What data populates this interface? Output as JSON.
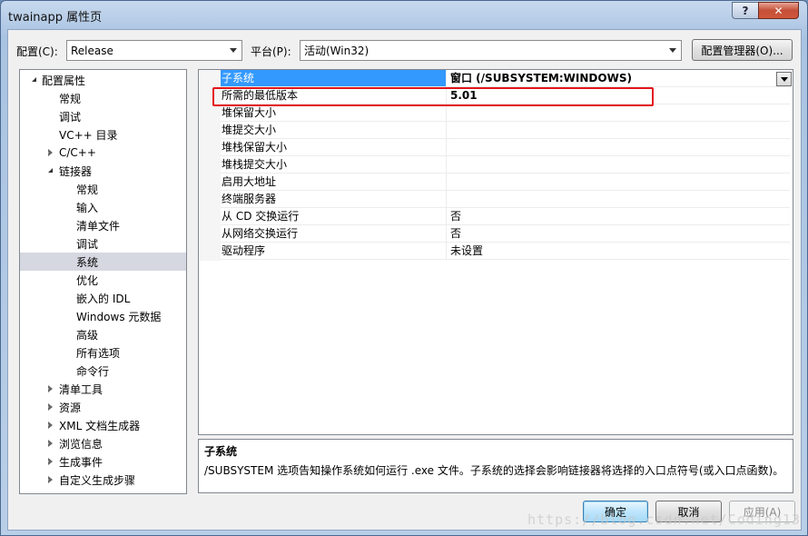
{
  "window": {
    "title": "twainapp 属性页",
    "help_label": "?",
    "close_label": "✕"
  },
  "toolbar": {
    "config_label": "配置(C):",
    "config_value": "Release",
    "platform_label": "平台(P):",
    "platform_value": "活动(Win32)",
    "config_manager_label": "配置管理器(O)..."
  },
  "tree": {
    "items": [
      {
        "label": "配置属性",
        "expander": "open"
      },
      {
        "label": "常规"
      },
      {
        "label": "调试"
      },
      {
        "label": "VC++ 目录"
      },
      {
        "label": "C/C++",
        "expander": "closed"
      },
      {
        "label": "链接器",
        "expander": "open"
      },
      {
        "label": "常规"
      },
      {
        "label": "输入"
      },
      {
        "label": "清单文件"
      },
      {
        "label": "调试"
      },
      {
        "label": "系统",
        "selected": true
      },
      {
        "label": "优化"
      },
      {
        "label": "嵌入的 IDL"
      },
      {
        "label": "Windows 元数据"
      },
      {
        "label": "高级"
      },
      {
        "label": "所有选项"
      },
      {
        "label": "命令行"
      },
      {
        "label": "清单工具",
        "expander": "closed"
      },
      {
        "label": "资源",
        "expander": "closed"
      },
      {
        "label": "XML 文档生成器",
        "expander": "closed"
      },
      {
        "label": "浏览信息",
        "expander": "closed"
      },
      {
        "label": "生成事件",
        "expander": "closed"
      },
      {
        "label": "自定义生成步骤",
        "expander": "closed"
      }
    ]
  },
  "properties": [
    {
      "name": "子系统",
      "value": "窗口 (/SUBSYSTEM:WINDOWS)",
      "selected": true
    },
    {
      "name": "所需的最低版本",
      "value": "5.01",
      "bold": true
    },
    {
      "name": "堆保留大小",
      "value": ""
    },
    {
      "name": "堆提交大小",
      "value": ""
    },
    {
      "name": "堆栈保留大小",
      "value": ""
    },
    {
      "name": "堆栈提交大小",
      "value": ""
    },
    {
      "name": "启用大地址",
      "value": ""
    },
    {
      "name": "终端服务器",
      "value": ""
    },
    {
      "name": "从 CD 交换运行",
      "value": "否"
    },
    {
      "name": "从网络交换运行",
      "value": "否"
    },
    {
      "name": "驱动程序",
      "value": "未设置"
    }
  ],
  "description": {
    "title": "子系统",
    "text": "/SUBSYSTEM 选项告知操作系统如何运行 .exe 文件。子系统的选择会影响链接器将选择的入口点符号(或入口点函数)。"
  },
  "buttons": {
    "ok": "确定",
    "cancel": "取消",
    "apply": "应用(A)"
  },
  "watermark": "https://blog.csdn.net/Coding13"
}
